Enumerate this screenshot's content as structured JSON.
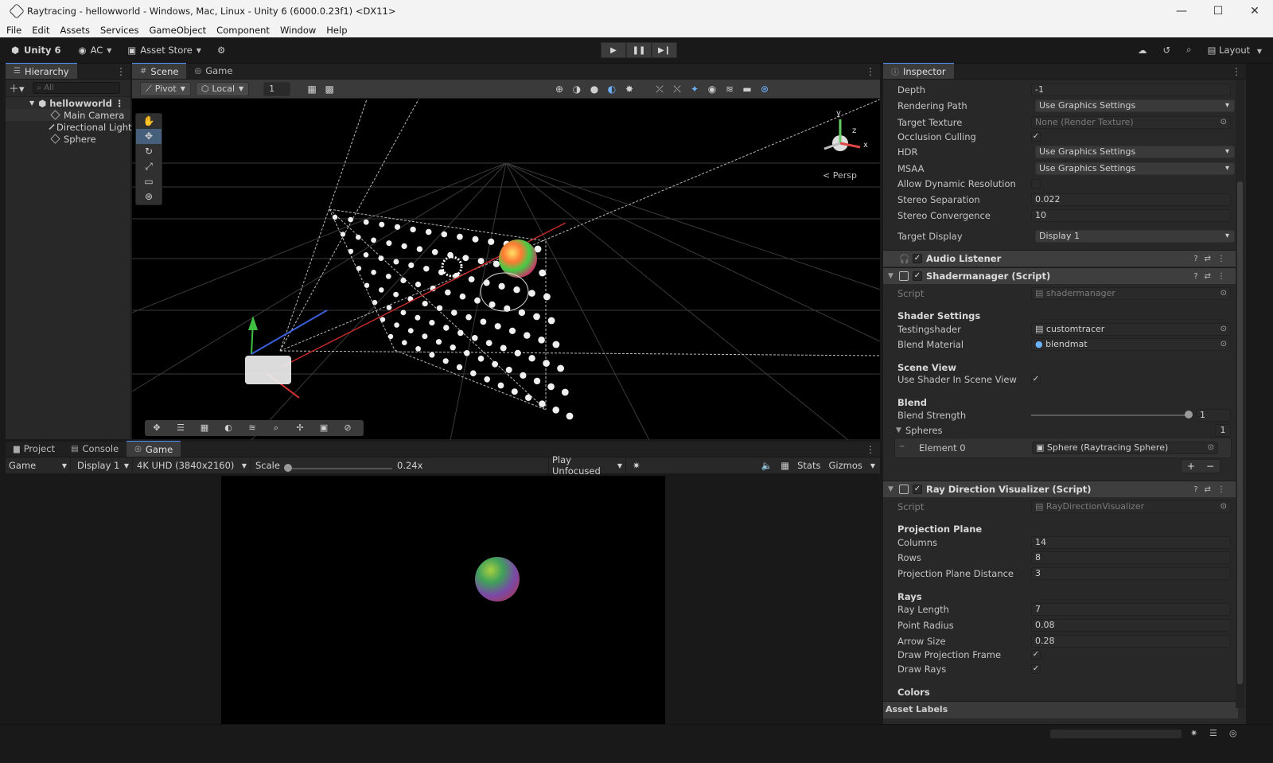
{
  "window": {
    "title": "Raytracing - hellowworld - Windows, Mac, Linux - Unity 6 (6000.0.23f1) <DX11>"
  },
  "menu": [
    "File",
    "Edit",
    "Assets",
    "Services",
    "GameObject",
    "Component",
    "Window",
    "Help"
  ],
  "toolbar": {
    "unity": "Unity 6",
    "account": "AC",
    "asset_store": "Asset Store",
    "layout": "Layout"
  },
  "hierarchy": {
    "tab": "Hierarchy",
    "search_placeholder": "All",
    "scene": "hellowworld",
    "items": [
      "Main Camera",
      "Directional Light",
      "Sphere"
    ]
  },
  "scene": {
    "tabs": [
      "Scene",
      "Game"
    ],
    "pivot": "Pivot",
    "local": "Local",
    "grid_value": "1",
    "persp": "Persp",
    "axes": {
      "y": "y",
      "z": "z",
      "x": "x"
    }
  },
  "bottom": {
    "tabs": [
      "Project",
      "Console",
      "Game"
    ],
    "game_dropdown": "Game",
    "display": "Display 1",
    "resolution": "4K UHD (3840x2160)",
    "scale_label": "Scale",
    "scale_value": "0.24x",
    "play_mode": "Play Unfocused",
    "stats": "Stats",
    "gizmos": "Gizmos"
  },
  "inspector": {
    "tab": "Inspector",
    "camera_rows": [
      {
        "label": "Depth",
        "value": "-1",
        "kind": "text"
      },
      {
        "label": "Rendering Path",
        "value": "Use Graphics Settings",
        "kind": "dropdown"
      },
      {
        "label": "Target Texture",
        "value": "None (Render Texture)",
        "kind": "object"
      },
      {
        "label": "Occlusion Culling",
        "value": "✓",
        "kind": "check"
      },
      {
        "label": "HDR",
        "value": "Use Graphics Settings",
        "kind": "dropdown"
      },
      {
        "label": "MSAA",
        "value": "Use Graphics Settings",
        "kind": "dropdown"
      },
      {
        "label": "Allow Dynamic Resolution",
        "value": "",
        "kind": "check"
      },
      {
        "label": "Stereo Separation",
        "value": "0.022",
        "kind": "text"
      },
      {
        "label": "Stereo Convergence",
        "value": "10",
        "kind": "text"
      },
      {
        "label": "Target Display",
        "value": "Display 1",
        "kind": "dropdown"
      }
    ],
    "audio_listener": "Audio Listener",
    "shadermanager": {
      "title": "Shadermanager (Script)",
      "script_label": "Script",
      "script_value": "shadermanager",
      "shader_settings": "Shader Settings",
      "testingshader_label": "Testingshader",
      "testingshader_value": "customtracer",
      "blend_material_label": "Blend Material",
      "blend_material_value": "blendmat",
      "scene_view": "Scene View",
      "use_shader_label": "Use Shader In Scene View",
      "use_shader_value": "✓",
      "blend": "Blend",
      "blend_strength_label": "Blend Strength",
      "blend_strength_value": "1",
      "blend_strength_fraction": 1.0,
      "spheres_label": "Spheres",
      "spheres_count": "1",
      "element0_label": "Element 0",
      "element0_value": "Sphere (Raytracing Sphere)",
      "plus": "+",
      "minus": "−"
    },
    "raydir": {
      "title": "Ray Direction Visualizer (Script)",
      "script_label": "Script",
      "script_value": "RayDirectionVisualizer",
      "projection_plane": "Projection Plane",
      "columns_label": "Columns",
      "columns_value": "14",
      "rows_label": "Rows",
      "rows_value": "8",
      "ppd_label": "Projection Plane Distance",
      "ppd_value": "3",
      "rays": "Rays",
      "ray_length_label": "Ray Length",
      "ray_length_value": "7",
      "point_radius_label": "Point Radius",
      "point_radius_value": "0.08",
      "arrow_size_label": "Arrow Size",
      "arrow_size_value": "0.28",
      "draw_pf_label": "Draw Projection Frame",
      "draw_pf_value": "✓",
      "draw_rays_label": "Draw Rays",
      "draw_rays_value": "✓",
      "colors": "Colors"
    },
    "asset_labels": "Asset Labels"
  },
  "colors": {
    "accent": "#4d90fe",
    "selected": "#46607c"
  }
}
